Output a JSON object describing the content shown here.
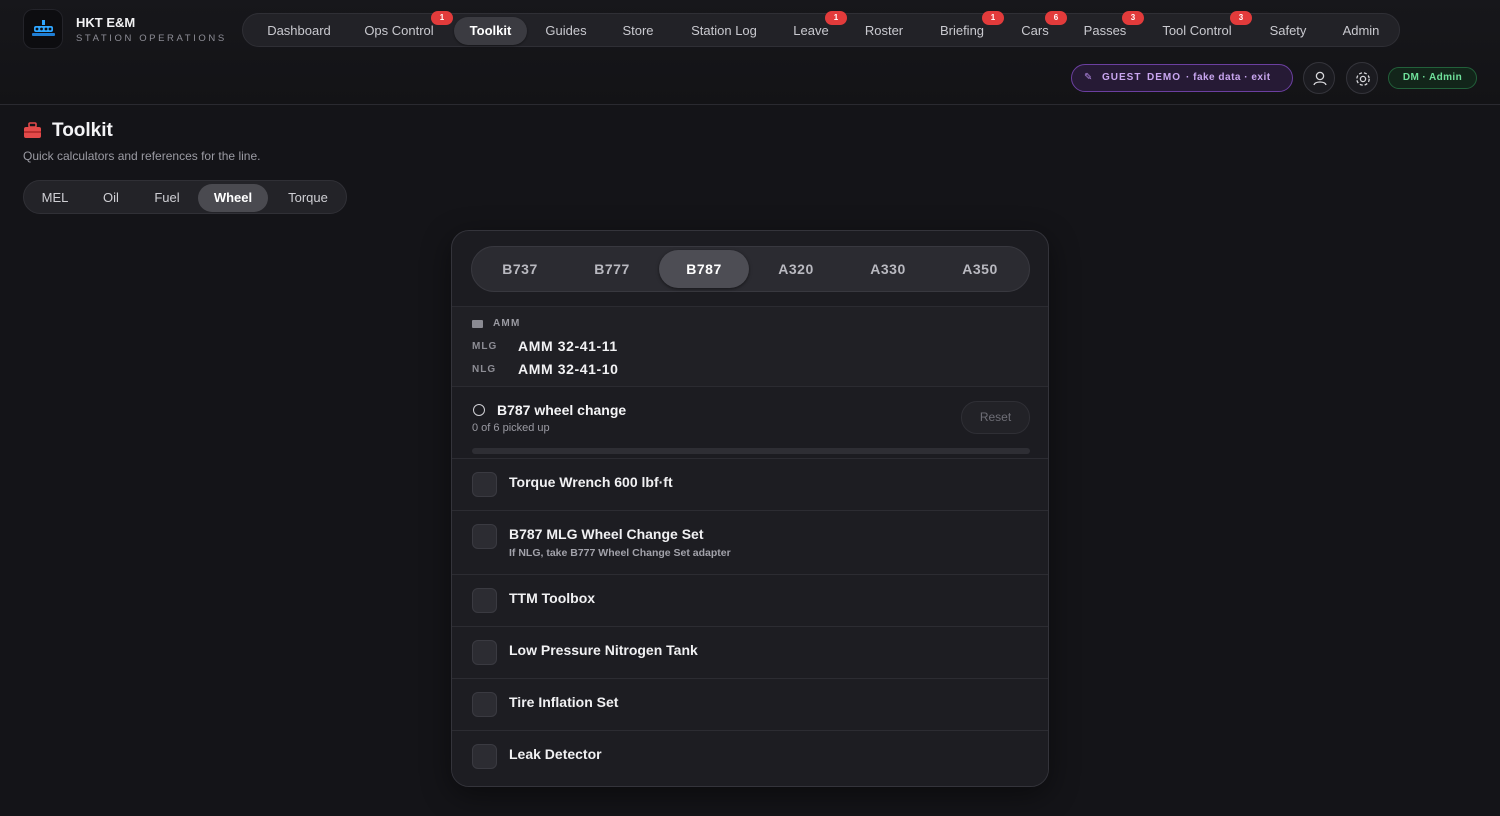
{
  "brand": {
    "name": "HKT E&M",
    "subtitle": "STATION OPERATIONS",
    "logo_icon": "ship-icon"
  },
  "nav": {
    "items": [
      {
        "label": "Dashboard",
        "badge": null,
        "active": false
      },
      {
        "label": "Ops Control",
        "badge": "1",
        "active": false
      },
      {
        "label": "Toolkit",
        "badge": null,
        "active": true
      },
      {
        "label": "Guides",
        "badge": null,
        "active": false
      },
      {
        "label": "Store",
        "badge": null,
        "active": false
      },
      {
        "label": "Station Log",
        "badge": null,
        "active": false
      },
      {
        "label": "Leave",
        "badge": "1",
        "active": false
      },
      {
        "label": "Roster",
        "badge": null,
        "active": false
      },
      {
        "label": "Briefing",
        "badge": "1",
        "active": false
      },
      {
        "label": "Cars",
        "badge": "6",
        "active": false
      },
      {
        "label": "Passes",
        "badge": "3",
        "active": false
      },
      {
        "label": "Tool Control",
        "badge": "3",
        "active": false
      },
      {
        "label": "Safety",
        "badge": null,
        "active": false
      },
      {
        "label": "Admin",
        "badge": null,
        "active": false
      }
    ],
    "badge_color": "#e23b3b"
  },
  "header_right": {
    "demo": {
      "guest": "GUEST",
      "demo": "DEMO",
      "fake": "· fake data · exit",
      "icon": "pencil-icon"
    },
    "profile_icon": "user-icon",
    "settings_icon": "gear-icon",
    "role": "DM · Admin"
  },
  "page": {
    "icon": "toolbox-icon",
    "title": "Toolkit",
    "subtitle": "Quick calculators and references for the line.",
    "tabs": [
      {
        "label": "MEL",
        "active": false
      },
      {
        "label": "Oil",
        "active": false
      },
      {
        "label": "Fuel",
        "active": false
      },
      {
        "label": "Wheel",
        "active": true
      },
      {
        "label": "Torque",
        "active": false
      }
    ]
  },
  "aircraft": {
    "tabs": [
      {
        "label": "B737",
        "active": false
      },
      {
        "label": "B777",
        "active": false
      },
      {
        "label": "B787",
        "active": true
      },
      {
        "label": "A320",
        "active": false
      },
      {
        "label": "A330",
        "active": false
      },
      {
        "label": "A350",
        "active": false
      }
    ]
  },
  "amm": {
    "heading": "AMM",
    "icon": "book-icon",
    "rows": [
      {
        "key": "MLG",
        "value": "AMM 32-41-11"
      },
      {
        "key": "NLG",
        "value": "AMM 32-41-10"
      }
    ]
  },
  "job": {
    "icon": "wheel-icon",
    "title": "B787 wheel change",
    "status": "0 of 6 picked up",
    "picked": 0,
    "total": 6,
    "reset_label": "Reset",
    "accent": "#6fe09a"
  },
  "checklist": [
    {
      "label": "Torque Wrench 600 lbf·ft",
      "note": "",
      "checked": false
    },
    {
      "label": "B787 MLG Wheel Change Set",
      "note": "If NLG, take B777 Wheel Change Set adapter",
      "checked": false
    },
    {
      "label": "TTM Toolbox",
      "note": "",
      "checked": false
    },
    {
      "label": "Low Pressure Nitrogen Tank",
      "note": "",
      "checked": false
    },
    {
      "label": "Tire Inflation Set",
      "note": "",
      "checked": false
    },
    {
      "label": "Leak Detector",
      "note": "",
      "checked": false
    }
  ]
}
